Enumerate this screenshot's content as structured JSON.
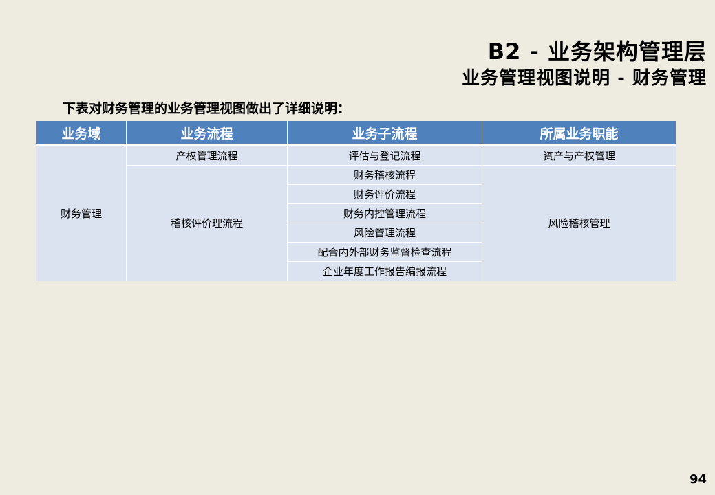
{
  "header": {
    "title": "B2 - 业务架构管理层",
    "subtitle": "业务管理视图说明 - 财务管理"
  },
  "intro": "下表对财务管理的业务管理视图做出了详细说明：",
  "table": {
    "columns": [
      "业务域",
      "业务流程",
      "业务子流程",
      "所属业务职能"
    ],
    "domain": "财务管理",
    "processes": [
      {
        "name": "产权管理流程",
        "function": "资产与产权管理",
        "subprocesses": [
          "评估与登记流程"
        ]
      },
      {
        "name": "稽核评价理流程",
        "function": "风险稽核管理",
        "subprocesses": [
          "财务稽核流程",
          "财务评价流程",
          "财务内控管理流程",
          "风险管理流程",
          "配合内外部财务监督检查流程",
          "企业年度工作报告编报流程"
        ]
      }
    ]
  },
  "page_number": "94",
  "colors": {
    "header_bg": "#4f81bd",
    "cell_bg": "#dbe3f0",
    "page_bg": "#eeebe0"
  }
}
